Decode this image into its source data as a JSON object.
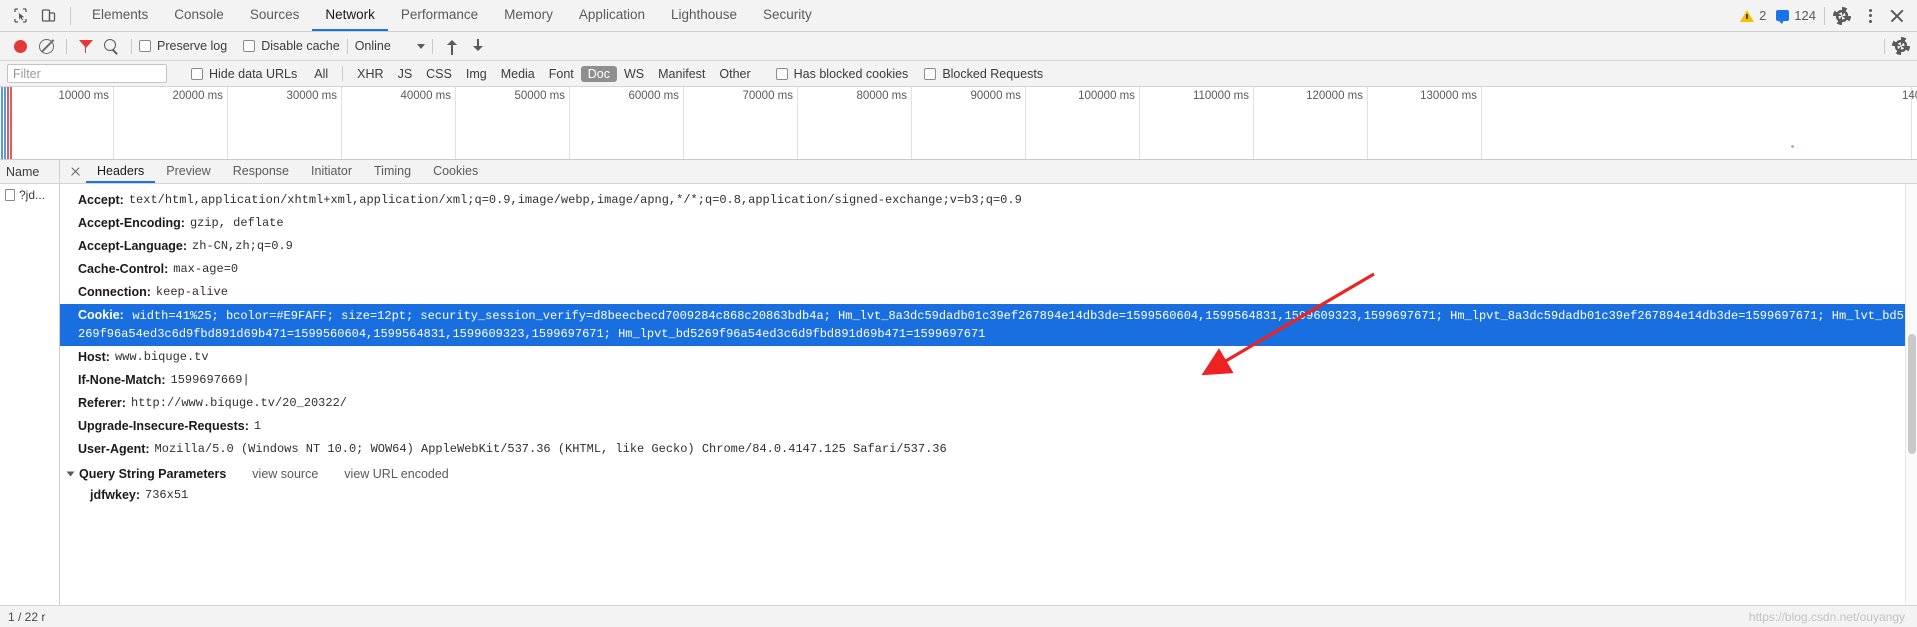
{
  "topbar": {
    "inspect_icon": "inspect-cursor-icon",
    "device_icon": "device-toolbar-icon",
    "tabs": [
      {
        "label": "Elements",
        "active": false
      },
      {
        "label": "Console",
        "active": false
      },
      {
        "label": "Sources",
        "active": false
      },
      {
        "label": "Network",
        "active": true
      },
      {
        "label": "Performance",
        "active": false
      },
      {
        "label": "Memory",
        "active": false
      },
      {
        "label": "Application",
        "active": false
      },
      {
        "label": "Lighthouse",
        "active": false
      },
      {
        "label": "Security",
        "active": false
      }
    ],
    "warning_count": "2",
    "message_count": "124",
    "settings_icon": "gear-icon",
    "more_icon": "kebab-menu-icon",
    "close_icon": "close-icon"
  },
  "network_toolbar": {
    "record_icon": "record-button-icon",
    "clear_icon": "clear-icon",
    "filter_icon": "filter-funnel-icon",
    "search_icon": "search-icon",
    "preserve_log_label": "Preserve log",
    "preserve_log_checked": false,
    "disable_cache_label": "Disable cache",
    "disable_cache_checked": false,
    "throttle_value": "Online",
    "import_icon": "import-har-icon",
    "export_icon": "export-har-icon",
    "settings_icon": "gear-icon"
  },
  "filter_row": {
    "filter_placeholder": "Filter",
    "filter_value": "",
    "hide_data_urls_label": "Hide data URLs",
    "hide_data_urls_checked": false,
    "types": [
      {
        "label": "All",
        "selected": false
      },
      {
        "label": "XHR",
        "selected": false
      },
      {
        "label": "JS",
        "selected": false
      },
      {
        "label": "CSS",
        "selected": false
      },
      {
        "label": "Img",
        "selected": false
      },
      {
        "label": "Media",
        "selected": false
      },
      {
        "label": "Font",
        "selected": false
      },
      {
        "label": "Doc",
        "selected": true
      },
      {
        "label": "WS",
        "selected": false
      },
      {
        "label": "Manifest",
        "selected": false
      },
      {
        "label": "Other",
        "selected": false
      }
    ],
    "has_blocked_cookies_label": "Has blocked cookies",
    "has_blocked_cookies_checked": false,
    "blocked_requests_label": "Blocked Requests",
    "blocked_requests_checked": false
  },
  "timeline": {
    "ticks": [
      "10000 ms",
      "20000 ms",
      "30000 ms",
      "40000 ms",
      "50000 ms",
      "60000 ms",
      "70000 ms",
      "80000 ms",
      "90000 ms",
      "100000 ms",
      "110000 ms",
      "120000 ms",
      "130000 ms",
      "140"
    ],
    "interval_ms": 10000
  },
  "name_column": {
    "header": "Name",
    "rows": [
      {
        "label": "?jd...",
        "icon": "document-icon"
      }
    ]
  },
  "detail_panel": {
    "close_icon": "close-icon",
    "tabs": [
      {
        "label": "Headers",
        "active": true
      },
      {
        "label": "Preview",
        "active": false
      },
      {
        "label": "Response",
        "active": false
      },
      {
        "label": "Initiator",
        "active": false
      },
      {
        "label": "Timing",
        "active": false
      },
      {
        "label": "Cookies",
        "active": false
      }
    ],
    "headers": [
      {
        "key": "Accept:",
        "value": "text/html,application/xhtml+xml,application/xml;q=0.9,image/webp,image/apng,*/*;q=0.8,application/signed-exchange;v=b3;q=0.9",
        "highlighted": false
      },
      {
        "key": "Accept-Encoding:",
        "value": "gzip, deflate",
        "highlighted": false
      },
      {
        "key": "Accept-Language:",
        "value": "zh-CN,zh;q=0.9",
        "highlighted": false
      },
      {
        "key": "Cache-Control:",
        "value": "max-age=0",
        "highlighted": false
      },
      {
        "key": "Connection:",
        "value": "keep-alive",
        "highlighted": false
      },
      {
        "key": "Cookie:",
        "value": "width=41%25; bcolor=#E9FAFF; size=12pt; security_session_verify=d8beecbecd7009284c868c20863bdb4a; Hm_lvt_8a3dc59dadb01c39ef267894e14db3de=1599560604,1599564831,1599609323,1599697671; Hm_lpvt_8a3dc59dadb01c39ef267894e14db3de=1599697671; Hm_lvt_bd5269f96a54ed3c6d9fbd891d69b471=1599560604,1599564831,1599609323,1599697671; Hm_lpvt_bd5269f96a54ed3c6d9fbd891d69b471=1599697671",
        "highlighted": true
      },
      {
        "key": "Host:",
        "value": "www.biquge.tv",
        "highlighted": false
      },
      {
        "key": "If-None-Match:",
        "value": "1599697669|",
        "highlighted": false
      },
      {
        "key": "Referer:",
        "value": "http://www.biquge.tv/20_20322/",
        "highlighted": false
      },
      {
        "key": "Upgrade-Insecure-Requests:",
        "value": "1",
        "highlighted": false
      },
      {
        "key": "User-Agent:",
        "value": "Mozilla/5.0 (Windows NT 10.0; WOW64) AppleWebKit/537.36 (KHTML, like Gecko) Chrome/84.0.4147.125 Safari/537.36",
        "highlighted": false
      }
    ],
    "query_string": {
      "expander": "expanded",
      "title": "Query String Parameters",
      "view_source_label": "view source",
      "view_url_encoded_label": "view URL encoded",
      "params": [
        {
          "key": "jdfwkey:",
          "value": "736x51"
        }
      ]
    }
  },
  "footer": {
    "status": "1 / 22 r",
    "watermark": "https://blog.csdn.net/ouyangy"
  },
  "colors": {
    "accent": "#1a73e8",
    "highlight_row": "#1a6fe0",
    "record_red": "#e53935",
    "warning_yellow": "#f5c000",
    "annotation_arrow": "#ee2222",
    "toolbar_bg": "#f3f3f3"
  },
  "annotation": {
    "arrow_name": "red-pointer-arrow",
    "points_to": "Cookie header row"
  }
}
